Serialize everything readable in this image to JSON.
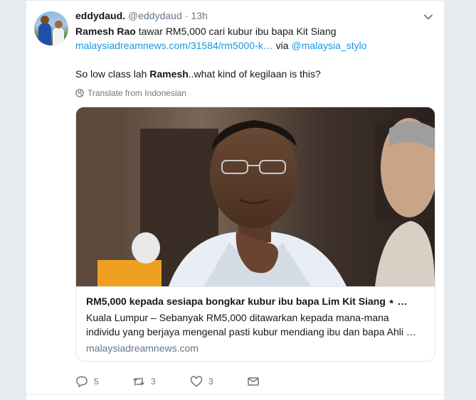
{
  "tweet": {
    "display_name": "eddydaud.",
    "handle": "@eddydaud",
    "separator": "·",
    "time": "13h",
    "line1_bold": "Ramesh Rao",
    "line1_rest": " tawar RM5,000 cari kubur ibu bapa Kit Siang",
    "line2_link": "malaysiadreamnews.com/31584/rm5000-k…",
    "line2_via": " via ",
    "line2_mention": "@malaysia_stylo",
    "line3_a": "So low class lah ",
    "line3_bold": "Ramesh",
    "line3_b": "..what kind of  kegilaan is this?",
    "translate": "Translate from Indonesian"
  },
  "card": {
    "title": "RM5,000 kepada sesiapa bongkar kubur ibu bapa Lim Kit Siang ⋆ …",
    "desc_line1": "Kuala Lumpur – Sebanyak RM5,000 ditawarkan kepada mana-mana",
    "desc_line2": "individu yang berjaya mengenal pasti kubur mendiang ibu dan bapa Ahli …",
    "domain": "malaysiadreamnews.com"
  },
  "actions": {
    "reply_count": "5",
    "retweet_count": "3",
    "like_count": "3"
  },
  "colors": {
    "link": "#1b95e0",
    "secondary_text": "#657786",
    "primary_text": "#14171a",
    "background": "#e6ecf0"
  },
  "icons": [
    "caret-down-icon",
    "globe-icon",
    "reply-icon",
    "retweet-icon",
    "like-icon",
    "message-icon"
  ]
}
